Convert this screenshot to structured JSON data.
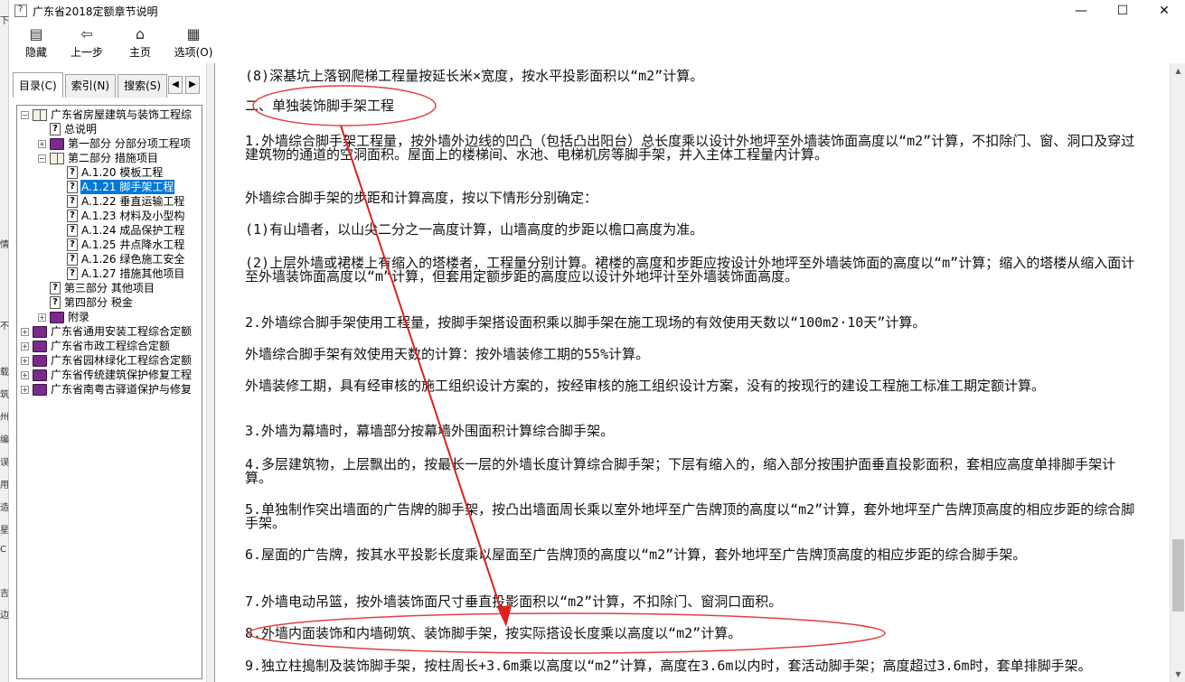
{
  "window": {
    "title": "广东省2018定额章节说明",
    "controls": [
      "—",
      "☐",
      "✕"
    ]
  },
  "background_fragments": [
    "下",
    "情",
    "不",
    "载",
    "筑",
    "州",
    "编",
    "误",
    "用",
    "造",
    "星",
    "C",
    "吉",
    "边"
  ],
  "toolbar": {
    "buttons": [
      {
        "name": "hide",
        "label": "隐藏",
        "icon": "hide-pane-icon"
      },
      {
        "name": "back",
        "label": "上一步",
        "icon": "back-arrow-icon"
      },
      {
        "name": "home",
        "label": "主页",
        "icon": "home-icon"
      },
      {
        "name": "options",
        "label": "选项(O)",
        "icon": "options-icon"
      }
    ]
  },
  "tabs": {
    "items": [
      "目录(C)",
      "索引(N)",
      "搜索(S)"
    ],
    "active": 0,
    "scroll_left": "◀",
    "scroll_right": "▶"
  },
  "tree": {
    "nodes": [
      {
        "label": "广东省房屋建筑与装饰工程综",
        "level": 0,
        "exp": "⊟",
        "icon": "open"
      },
      {
        "label": "总说明",
        "level": 1,
        "exp": "",
        "icon": "page"
      },
      {
        "label": "第一部分 分部分项工程项",
        "level": 1,
        "exp": "⊞",
        "icon": "closed"
      },
      {
        "label": "第二部分 措施项目",
        "level": 1,
        "exp": "⊟",
        "icon": "open"
      },
      {
        "label": "A.1.20 模板工程",
        "level": 2,
        "exp": "",
        "icon": "page"
      },
      {
        "label": "A.1.21 脚手架工程",
        "level": 2,
        "exp": "",
        "icon": "page",
        "selected": true
      },
      {
        "label": "A.1.22 垂直运输工程",
        "level": 2,
        "exp": "",
        "icon": "page"
      },
      {
        "label": "A.1.23 材料及小型构",
        "level": 2,
        "exp": "",
        "icon": "page"
      },
      {
        "label": "A.1.24 成品保护工程",
        "level": 2,
        "exp": "",
        "icon": "page"
      },
      {
        "label": "A.1.25 井点降水工程",
        "level": 2,
        "exp": "",
        "icon": "page"
      },
      {
        "label": "A.1.26 绿色施工安全",
        "level": 2,
        "exp": "",
        "icon": "page"
      },
      {
        "label": "A.1.27 措施其他项目",
        "level": 2,
        "exp": "",
        "icon": "page"
      },
      {
        "label": "第三部分 其他项目",
        "level": 1,
        "exp": "",
        "icon": "page"
      },
      {
        "label": "第四部分 税金",
        "level": 1,
        "exp": "",
        "icon": "page"
      },
      {
        "label": "附录",
        "level": 1,
        "exp": "⊞",
        "icon": "closed"
      },
      {
        "label": "广东省通用安装工程综合定额",
        "level": 0,
        "exp": "⊞",
        "icon": "closed"
      },
      {
        "label": "广东省市政工程综合定额",
        "level": 0,
        "exp": "⊞",
        "icon": "closed"
      },
      {
        "label": "广东省园林绿化工程综合定额",
        "level": 0,
        "exp": "⊞",
        "icon": "closed"
      },
      {
        "label": "广东省传统建筑保护修复工程",
        "level": 0,
        "exp": "⊞",
        "icon": "closed"
      },
      {
        "label": "广东省南粤古驿道保护与修复",
        "level": 0,
        "exp": "⊞",
        "icon": "closed"
      }
    ]
  },
  "content": {
    "paragraphs": [
      "(8)深基坑上落钢爬梯工程量按延长米×宽度，按水平投影面积以“m2”计算。",
      "二、单独装饰脚手架工程",
      "1.外墙综合脚手架工程量，按外墙外边线的凹凸（包括凸出阳台）总长度乘以设计外地坪至外墙装饰面高度以“m2”计算，不扣除门、窗、洞口及穿过建筑物的通道的空洞面积。屋面上的楼梯间、水池、电梯机房等脚手架，并入主体工程量内计算。",
      "外墙综合脚手架的步距和计算高度，按以下情形分别确定：",
      "(1)有山墙者，以山尖二分之一高度计算，山墙高度的步距以檐口高度为准。",
      "(2)上层外墙或裙楼上有缩入的塔楼者，工程量分别计算。裙楼的高度和步距应按设计外地坪至外墙装饰面的高度以“m”计算；缩入的塔楼从缩入面计至外墙装饰面高度以“m”计算，但套用定额步距的高度应以设计外地坪计至外墙装饰面高度。",
      "2.外墙综合脚手架使用工程量，按脚手架搭设面积乘以脚手架在施工现场的有效使用天数以“100m2·10天”计算。",
      "外墙综合脚手架有效使用天数的计算：按外墙装修工期的55%计算。",
      "外墙装修工期，具有经审核的施工组织设计方案的，按经审核的施工组织设计方案，没有的按现行的建设工程施工标准工期定额计算。",
      "3.外墙为幕墙时，幕墙部分按幕墙外围面积计算综合脚手架。",
      "4.多层建筑物，上层飘出的，按最长一层的外墙长度计算综合脚手架；下层有缩入的，缩入部分按围护面垂直投影面积，套相应高度单排脚手架计算。",
      "5.单独制作突出墙面的广告牌的脚手架，按凸出墙面周长乘以室外地坪至广告牌顶的高度以“m2”计算，套外地坪至广告牌顶高度的相应步距的综合脚手架。",
      "6.屋面的广告牌，按其水平投影长度乘以屋面至广告牌顶的高度以“m2”计算，套外地坪至广告牌顶高度的相应步距的综合脚手架。",
      "7.外墙电动吊篮，按外墙装饰面尺寸垂直投影面积以“m2”计算，不扣除门、窗洞口面积。",
      "8.外墙内面装饰和内墙砌筑、装饰脚手架，按实际搭设长度乘以高度以“m2”计算。",
      "9.独立柱搗制及装饰脚手架，按柱周长+3.6m乘以高度以“m2”计算，高度在3.6m以内时，套活动脚手架；高度超过3.6m时，套单排脚手架。"
    ]
  },
  "annotation_colors": {
    "ellipse": "#e04040",
    "arrow": "#e02020"
  }
}
